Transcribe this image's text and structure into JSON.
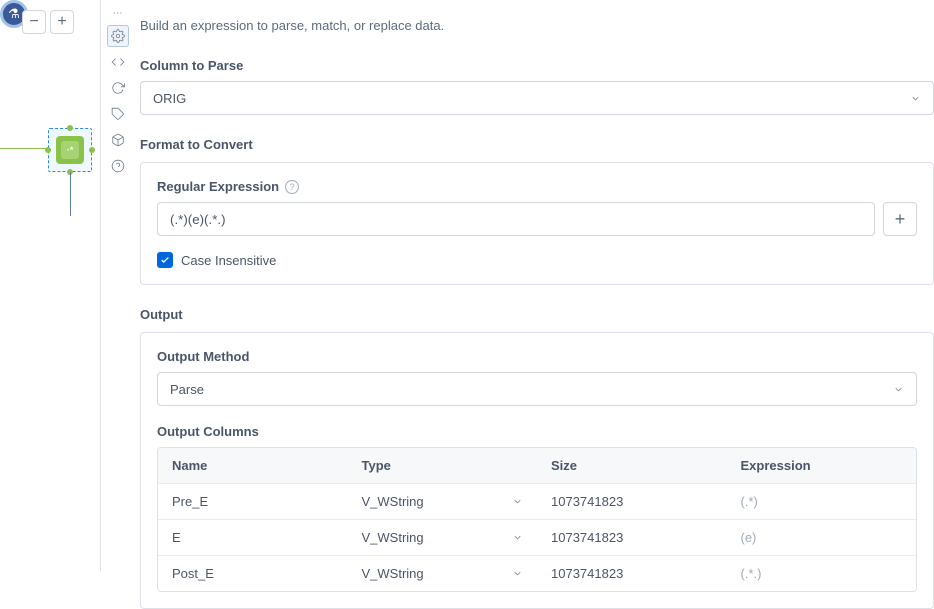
{
  "description": "Build an expression to parse, match, or replace data.",
  "column_to_parse": {
    "label": "Column to Parse",
    "value": "ORIG"
  },
  "format_to_convert": {
    "label": "Format to Convert",
    "regex_label": "Regular Expression",
    "regex_value": "(.*)(e)(.*.)",
    "case_insensitive_label": "Case Insensitive",
    "case_insensitive_checked": true
  },
  "output": {
    "label": "Output",
    "method_label": "Output Method",
    "method_value": "Parse",
    "columns_label": "Output Columns",
    "headers": {
      "name": "Name",
      "type": "Type",
      "size": "Size",
      "expression": "Expression"
    },
    "rows": [
      {
        "name": "Pre_E",
        "type": "V_WString",
        "size": "1073741823",
        "expression": "(.*)"
      },
      {
        "name": "E",
        "type": "V_WString",
        "size": "1073741823",
        "expression": "(e)"
      },
      {
        "name": "Post_E",
        "type": "V_WString",
        "size": "1073741823",
        "expression": "(.*.)"
      }
    ]
  },
  "sidebar_icons": [
    "gear-icon",
    "code-icon",
    "refresh-icon",
    "tag-icon",
    "cube-icon",
    "question-icon"
  ]
}
